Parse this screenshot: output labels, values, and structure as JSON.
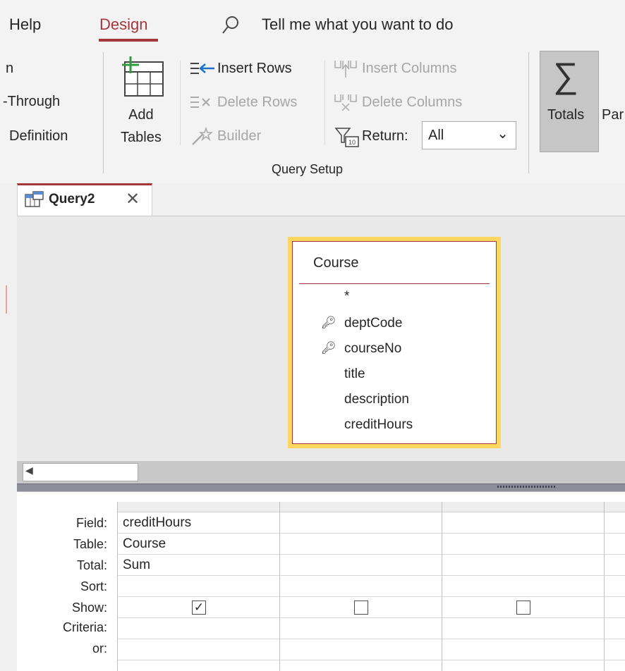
{
  "ribbon": {
    "tabs": {
      "help": "Help",
      "design": "Design"
    },
    "search": {
      "placeholder": "Tell me what you want to do",
      "icon": "search-icon"
    },
    "query_type_partial": {
      "item1": "n",
      "item2": "-Through",
      "item3": "Definition"
    },
    "add_tables": {
      "line1": "Add",
      "line2": "Tables",
      "icon": "add-tables-icon"
    },
    "insert_rows": "Insert Rows",
    "delete_rows": "Delete Rows",
    "builder": "Builder",
    "insert_columns": "Insert Columns",
    "delete_columns": "Delete Columns",
    "return_label": "Return:",
    "return_value": "All",
    "group_label": "Query Setup",
    "totals": "Totals",
    "parameters_partial": "Par"
  },
  "document": {
    "tab_title": "Query2",
    "close_icon": "close-icon"
  },
  "table": {
    "name": "Course",
    "fields": [
      {
        "name": "*",
        "key": false
      },
      {
        "name": "deptCode",
        "key": true
      },
      {
        "name": "courseNo",
        "key": true
      },
      {
        "name": "title",
        "key": false
      },
      {
        "name": "description",
        "key": false
      },
      {
        "name": "creditHours",
        "key": false
      }
    ]
  },
  "grid": {
    "row_labels": {
      "field": "Field:",
      "table": "Table:",
      "total": "Total:",
      "sort": "Sort:",
      "show": "Show:",
      "criteria": "Criteria:",
      "or": "or:"
    },
    "columns": [
      {
        "field": "creditHours",
        "table": "Course",
        "total": "Sum",
        "sort": "",
        "show": true,
        "criteria": "",
        "or": ""
      },
      {
        "field": "",
        "table": "",
        "total": "",
        "sort": "",
        "show": false,
        "criteria": "",
        "or": ""
      },
      {
        "field": "",
        "table": "",
        "total": "",
        "sort": "",
        "show": false,
        "criteria": "",
        "or": ""
      }
    ]
  },
  "colors": {
    "accent": "#a4373a",
    "table_highlight": "#ffd75e"
  }
}
